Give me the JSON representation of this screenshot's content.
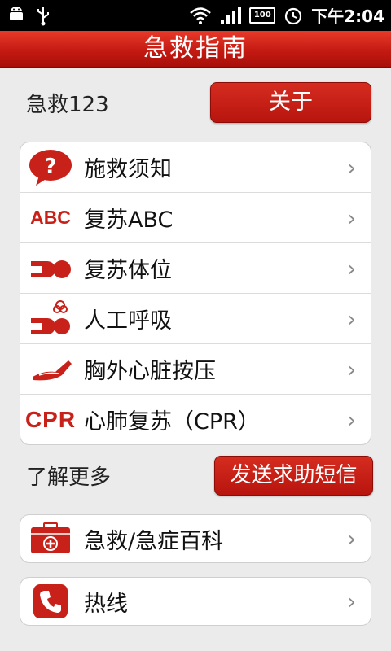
{
  "status_bar": {
    "time": "下午2:04",
    "left_icons": [
      "android-icon",
      "usb-icon"
    ],
    "right_icons": [
      "wifi-icon",
      "signal-icon",
      "battery-icon",
      "alarm-icon"
    ],
    "battery_label": "100"
  },
  "header": {
    "title": "急救指南"
  },
  "top_section": {
    "label": "急救123",
    "about_button": "关于"
  },
  "main_list": [
    {
      "label": "施救须知",
      "icon": "question-bubble-icon"
    },
    {
      "label": "复苏ABC",
      "icon": "abc-icon",
      "icon_text": "ABC"
    },
    {
      "label": "复苏体位",
      "icon": "recovery-position-icon"
    },
    {
      "label": "人工呼吸",
      "icon": "breathing-icon"
    },
    {
      "label": "胸外心脏按压",
      "icon": "chest-compression-icon"
    },
    {
      "label": "心肺复苏（CPR）",
      "icon": "cpr-icon",
      "icon_text": "CPR"
    }
  ],
  "learn_more": {
    "label": "了解更多",
    "sms_button": "发送求助短信"
  },
  "encyclopedia": {
    "label": "急救/急症百科",
    "icon": "first-aid-kit-icon"
  },
  "hotline": {
    "label": "热线",
    "icon": "phone-icon"
  },
  "colors": {
    "accent": "#c41a12",
    "background": "#ebebeb"
  }
}
